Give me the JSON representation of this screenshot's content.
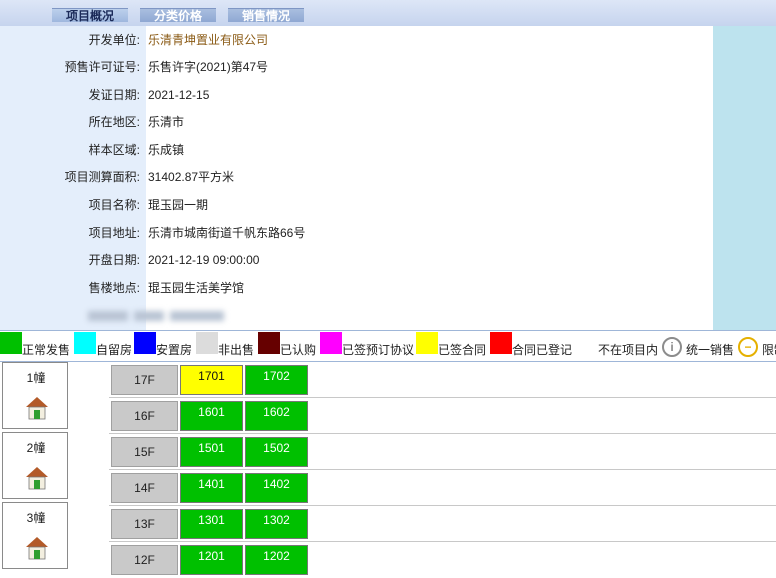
{
  "tabs": [
    {
      "label": "项目概况",
      "active": true
    },
    {
      "label": "分类价格",
      "active": false
    },
    {
      "label": "销售情况",
      "active": false
    }
  ],
  "info": [
    {
      "label": "开发单位:",
      "value": "乐清青坤置业有限公司",
      "link": true
    },
    {
      "label": "预售许可证号:",
      "value": "乐售许字(2021)第47号",
      "link": false
    },
    {
      "label": "发证日期:",
      "value": "2021-12-15",
      "link": false
    },
    {
      "label": "所在地区:",
      "value": "乐清市",
      "link": false
    },
    {
      "label": "样本区域:",
      "value": "乐成镇",
      "link": false
    },
    {
      "label": "项目测算面积:",
      "value": "31402.87平方米",
      "link": false
    },
    {
      "label": "项目名称:",
      "value": "琨玉园一期",
      "link": false
    },
    {
      "label": "项目地址:",
      "value": "乐清市城南街道千帆东路66号",
      "link": false
    },
    {
      "label": "开盘日期:",
      "value": "2021-12-19 09:00:00",
      "link": false
    },
    {
      "label": "售楼地点:",
      "value": "琨玉园生活美学馆",
      "link": false
    }
  ],
  "legend": [
    {
      "label": "正常发售",
      "color": "#00c000"
    },
    {
      "label": "自留房",
      "color": "#00ffff"
    },
    {
      "label": "安置房",
      "color": "#0000ff"
    },
    {
      "label": "非出售",
      "color": "#dcdcdc"
    },
    {
      "label": "已认购",
      "color": "#660000"
    },
    {
      "label": "已签预订协议",
      "color": "#ff00ff"
    },
    {
      "label": "已签合同",
      "color": "#ffff00"
    },
    {
      "label": "合同已登记",
      "color": "#ff0000"
    },
    {
      "label": "不在项目内",
      "color": "#ffffff"
    }
  ],
  "legend_icons": [
    {
      "label": "统一销售",
      "icon": "info-circle-icon"
    },
    {
      "label": "限制",
      "icon": "minus-circle-icon"
    }
  ],
  "buildings": [
    {
      "name": "1幢",
      "icon": "house-icon"
    },
    {
      "name": "2幢",
      "icon": "house-icon"
    },
    {
      "name": "3幢",
      "icon": "house-icon"
    }
  ],
  "floors": [
    {
      "floor": "17F",
      "units": [
        {
          "no": "1701",
          "status": "yellow"
        },
        {
          "no": "1702",
          "status": "green"
        }
      ]
    },
    {
      "floor": "16F",
      "units": [
        {
          "no": "1601",
          "status": "green"
        },
        {
          "no": "1602",
          "status": "green"
        }
      ]
    },
    {
      "floor": "15F",
      "units": [
        {
          "no": "1501",
          "status": "green"
        },
        {
          "no": "1502",
          "status": "green"
        }
      ]
    },
    {
      "floor": "14F",
      "units": [
        {
          "no": "1401",
          "status": "green"
        },
        {
          "no": "1402",
          "status": "green"
        }
      ]
    },
    {
      "floor": "13F",
      "units": [
        {
          "no": "1301",
          "status": "green"
        },
        {
          "no": "1302",
          "status": "green"
        }
      ]
    },
    {
      "floor": "12F",
      "units": [
        {
          "no": "1201",
          "status": "green"
        },
        {
          "no": "1202",
          "status": "green"
        }
      ]
    }
  ]
}
